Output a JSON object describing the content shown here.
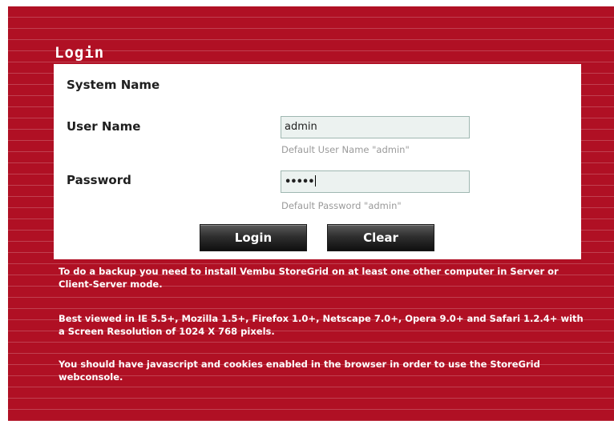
{
  "login": {
    "title": "Login",
    "system_name_label": "System Name",
    "username": {
      "label": "User Name",
      "value": "admin",
      "hint": "Default User Name \"admin\""
    },
    "password": {
      "label": "Password",
      "value": "•••••",
      "hint": "Default Password \"admin\""
    },
    "login_button": "Login",
    "clear_button": "Clear"
  },
  "info": {
    "line1": "To do a backup you need to install Vembu StoreGrid on at least one other computer in Server or Client-Server mode.",
    "line2": "Best viewed in IE 5.5+, Mozilla 1.5+, Firefox 1.0+, Netscape 7.0+, Opera 9.0+ and Safari 1.2.4+ with a Screen Resolution of 1024 X 768 pixels.",
    "line3": "You should have javascript and cookies enabled in the browser in order to use the StoreGrid webconsole."
  },
  "colors": {
    "panel_background": "#b01024",
    "form_background": "#ffffff",
    "field_background": "#ecf2f0",
    "button_background": "#1f1f1f"
  }
}
